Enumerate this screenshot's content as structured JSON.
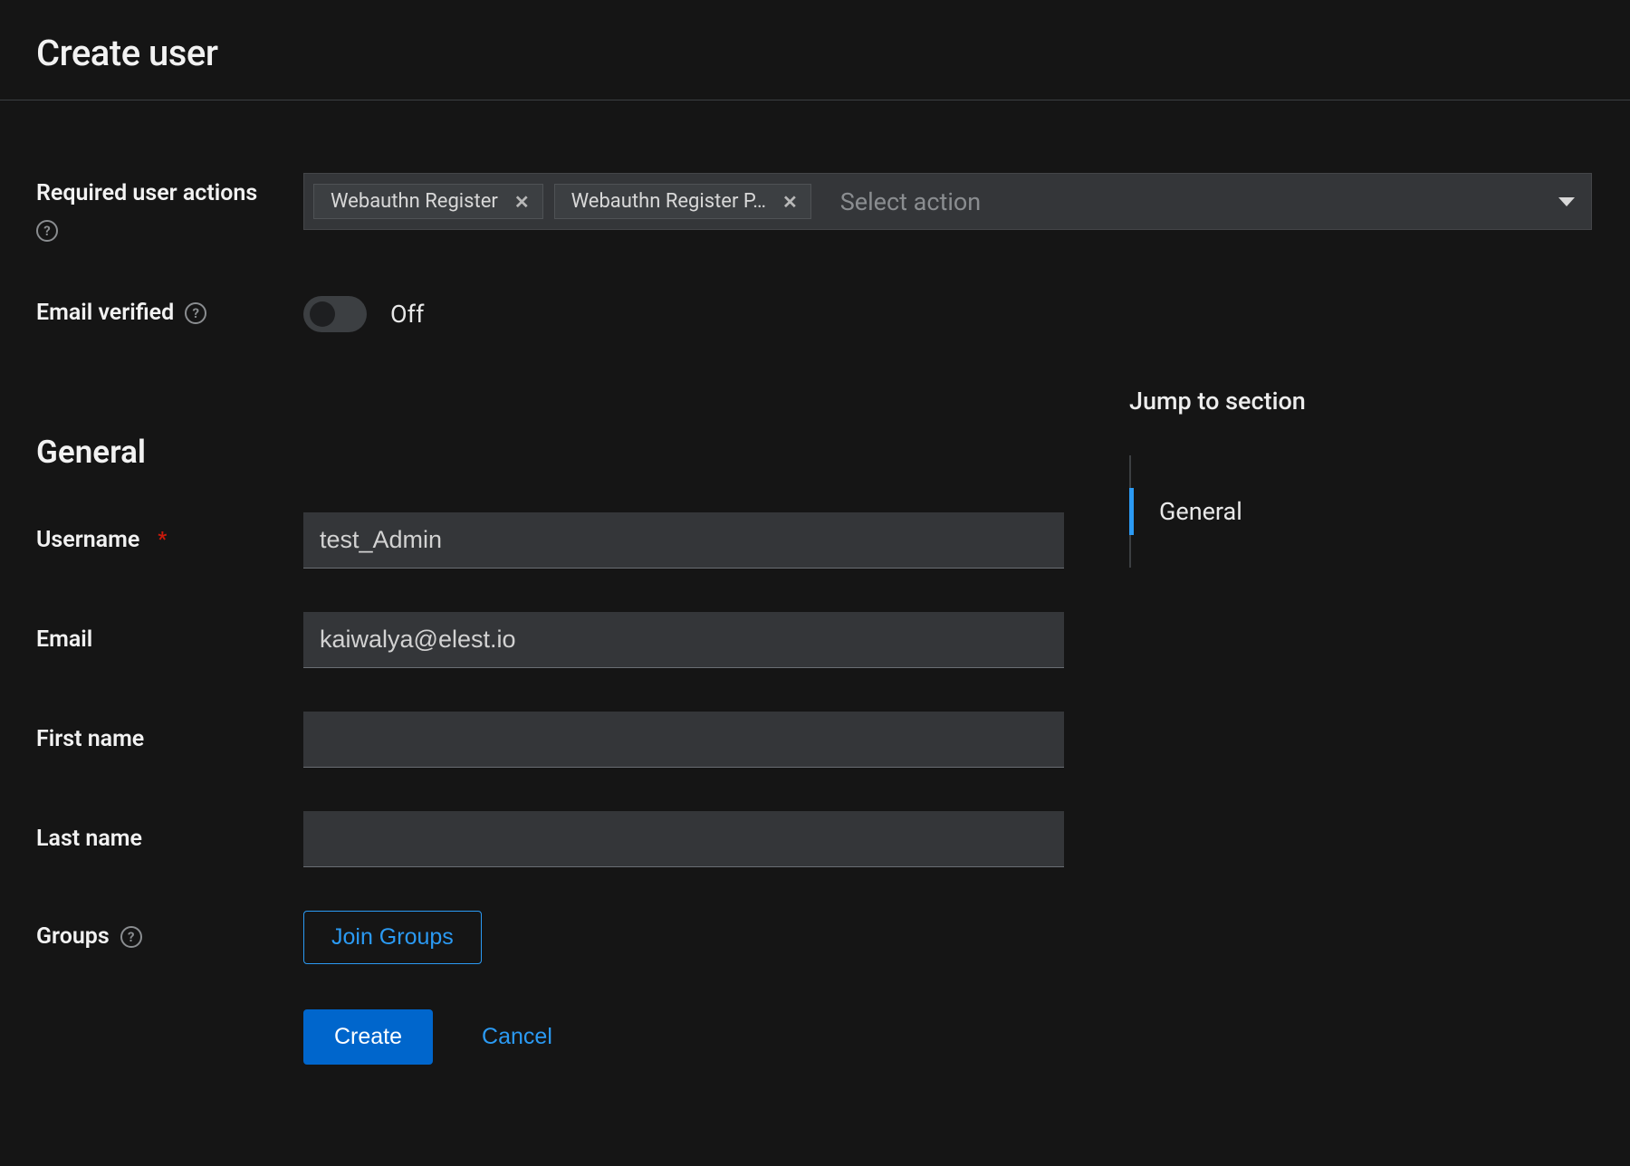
{
  "header": {
    "title": "Create user"
  },
  "required_actions": {
    "label": "Required user actions",
    "placeholder": "Select action",
    "chips": [
      "Webauthn Register",
      "Webauthn Register P…"
    ]
  },
  "email_verified": {
    "label": "Email verified",
    "state_text": "Off",
    "value": false
  },
  "sections": {
    "general_heading": "General"
  },
  "general": {
    "username_label": "Username",
    "username_value": "test_Admin",
    "email_label": "Email",
    "email_value": "kaiwalya@elest.io",
    "first_name_label": "First name",
    "first_name_value": "",
    "last_name_label": "Last name",
    "last_name_value": "",
    "groups_label": "Groups",
    "join_groups_button": "Join Groups"
  },
  "actions": {
    "create": "Create",
    "cancel": "Cancel"
  },
  "jump": {
    "title": "Jump to section",
    "items": [
      "General"
    ],
    "active_index": 0
  },
  "colors": {
    "accent": "#2b9af3",
    "primary_button": "#0066cc",
    "background": "#151515",
    "surface": "#343639"
  }
}
